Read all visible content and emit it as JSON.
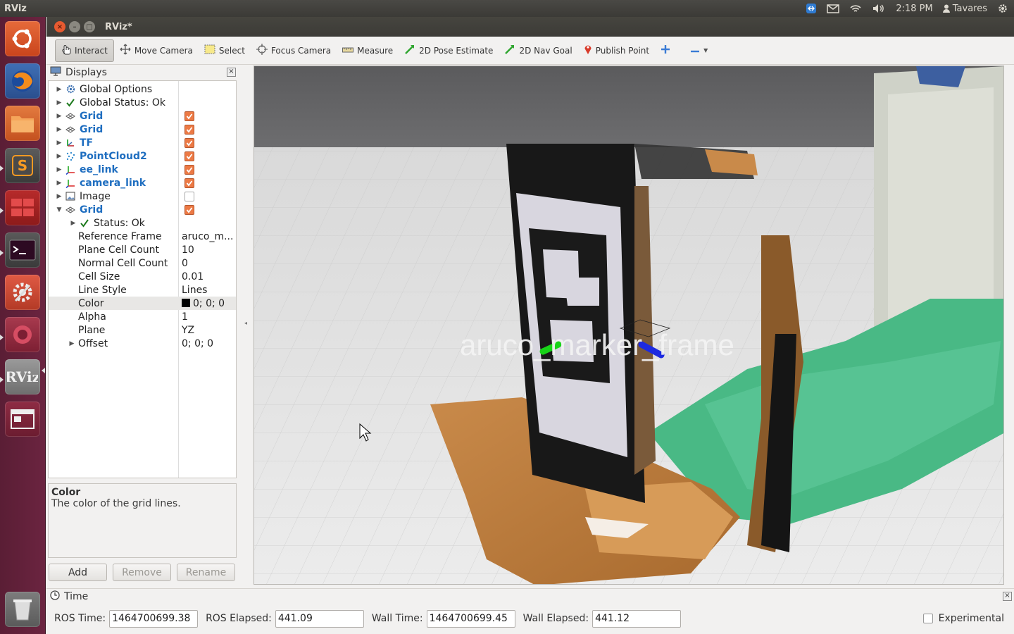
{
  "top_panel": {
    "app_name": "RViz",
    "clock": "2:18 PM",
    "user": "Tavares"
  },
  "launcher": {
    "items": [
      "ubuntu-dash-icon",
      "firefox-icon",
      "files-icon",
      "sublime-text-icon",
      "workspace-switcher-icon",
      "terminal-icon",
      "system-settings-icon",
      "app-icon",
      "rviz-icon",
      "window-icon",
      "trash-icon"
    ]
  },
  "window": {
    "title": "RViz*"
  },
  "toolbar": {
    "interact": "Interact",
    "move_camera": "Move Camera",
    "select": "Select",
    "focus_camera": "Focus Camera",
    "measure": "Measure",
    "pose_estimate": "2D Pose Estimate",
    "nav_goal": "2D Nav Goal",
    "publish_point": "Publish Point"
  },
  "displays": {
    "title": "Displays",
    "rows": [
      {
        "label": "Global Options",
        "blue": false,
        "check": null,
        "value": ""
      },
      {
        "label": "Global Status: Ok",
        "blue": false,
        "check": null,
        "value": ""
      },
      {
        "label": "Grid",
        "blue": true,
        "check": true,
        "value": ""
      },
      {
        "label": "Grid",
        "blue": true,
        "check": true,
        "value": ""
      },
      {
        "label": "TF",
        "blue": true,
        "check": true,
        "value": ""
      },
      {
        "label": "PointCloud2",
        "blue": true,
        "check": true,
        "value": ""
      },
      {
        "label": "ee_link",
        "blue": true,
        "check": true,
        "value": ""
      },
      {
        "label": "camera_link",
        "blue": true,
        "check": true,
        "value": ""
      },
      {
        "label": "Image",
        "blue": false,
        "check": false,
        "value": ""
      },
      {
        "label": "Grid",
        "blue": true,
        "check": true,
        "value": ""
      },
      {
        "label": "Status: Ok",
        "blue": false,
        "check": null,
        "value": ""
      },
      {
        "label": "Reference Frame",
        "blue": false,
        "check": null,
        "value": "aruco_m..."
      },
      {
        "label": "Plane Cell Count",
        "blue": false,
        "check": null,
        "value": "10"
      },
      {
        "label": "Normal Cell Count",
        "blue": false,
        "check": null,
        "value": "0"
      },
      {
        "label": "Cell Size",
        "blue": false,
        "check": null,
        "value": "0.01"
      },
      {
        "label": "Line Style",
        "blue": false,
        "check": null,
        "value": "Lines"
      },
      {
        "label": "Color",
        "blue": false,
        "check": null,
        "value": "0; 0; 0"
      },
      {
        "label": "Alpha",
        "blue": false,
        "check": null,
        "value": "1"
      },
      {
        "label": "Plane",
        "blue": false,
        "check": null,
        "value": "YZ"
      },
      {
        "label": "Offset",
        "blue": false,
        "check": null,
        "value": "0; 0; 0"
      }
    ],
    "help_title": "Color",
    "help_text": "The color of the grid lines.",
    "add": "Add",
    "remove": "Remove",
    "rename": "Rename"
  },
  "view": {
    "frame_label": "aruco_marker_frame"
  },
  "time": {
    "title": "Time",
    "ros_time_label": "ROS Time:",
    "ros_time": "1464700699.38",
    "ros_elapsed_label": "ROS Elapsed:",
    "ros_elapsed": "441.09",
    "wall_time_label": "Wall Time:",
    "wall_time": "1464700699.45",
    "wall_elapsed_label": "Wall Elapsed:",
    "wall_elapsed": "441.12",
    "experimental": "Experimental"
  }
}
